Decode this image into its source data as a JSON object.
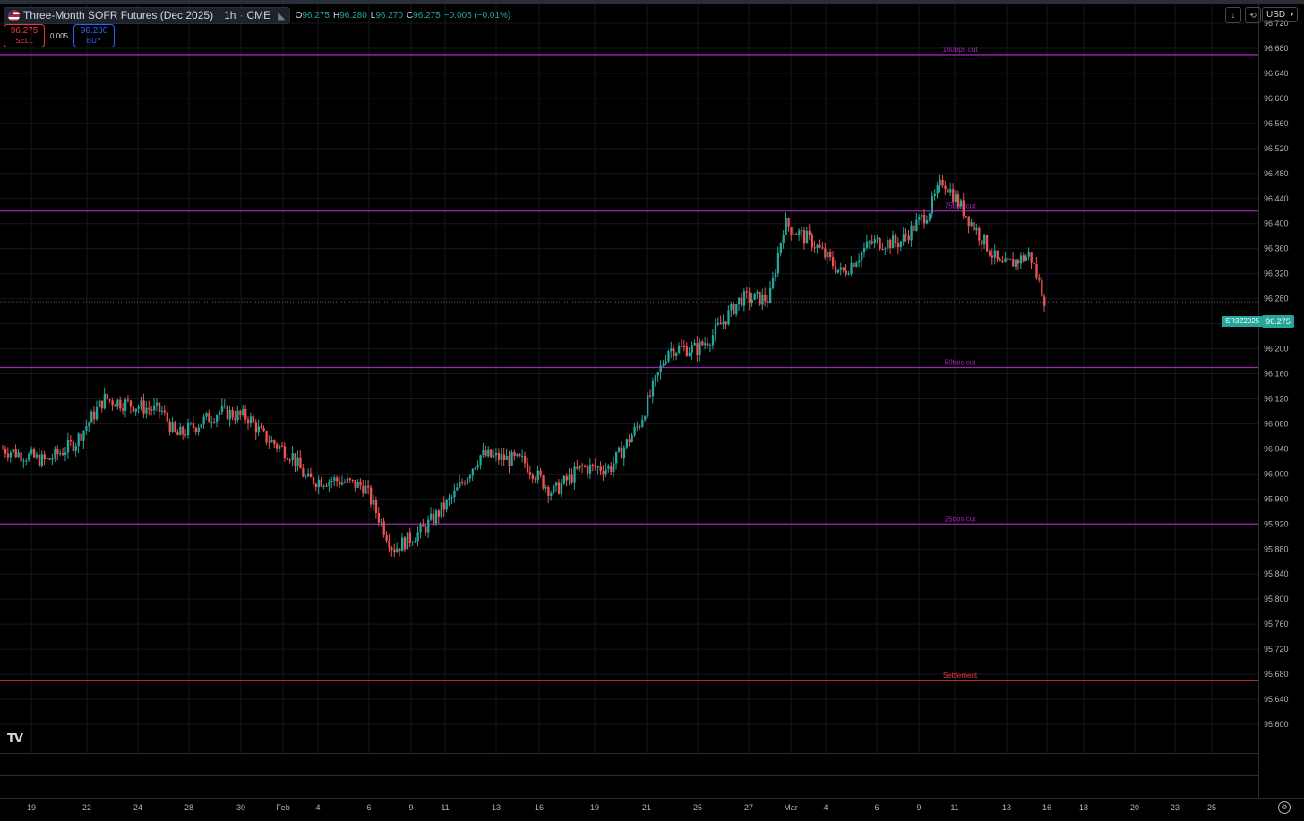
{
  "header": {
    "symbol_title": "Three-Month SOFR Futures (Dec 2025)",
    "interval": "1h",
    "exchange": "CME",
    "ohlc": {
      "o_label": "O",
      "o": "96.275",
      "h_label": "H",
      "h": "96.280",
      "l_label": "L",
      "l": "96.270",
      "c_label": "C",
      "c": "96.275",
      "change": "−0.005 (−0.01%)"
    }
  },
  "trade": {
    "sell_price": "96.275",
    "sell_label": "SELL",
    "spread": "0.005",
    "buy_price": "96.280",
    "buy_label": "BUY"
  },
  "toolbar": {
    "currency": "USD"
  },
  "last_price": {
    "ticker": "SR3Z2025",
    "value": "96.275"
  },
  "colors": {
    "up": "#26a69a",
    "down": "#ef5350",
    "level": "#9c27b0",
    "settlement": "#f23645"
  },
  "price_axis": [
    "96.720",
    "96.680",
    "96.640",
    "96.600",
    "96.560",
    "96.520",
    "96.480",
    "96.440",
    "96.400",
    "96.360",
    "96.320",
    "96.280",
    "96.240",
    "96.200",
    "96.160",
    "96.120",
    "96.080",
    "96.040",
    "96.000",
    "95.960",
    "95.920",
    "95.880",
    "95.840",
    "95.800",
    "95.760",
    "95.720",
    "95.680",
    "95.640",
    "95.600"
  ],
  "time_axis": [
    "19",
    "22",
    "24",
    "28",
    "30",
    "Feb",
    "4",
    "6",
    "9",
    "11",
    "13",
    "16",
    "19",
    "21",
    "25",
    "27",
    "Mar",
    "4",
    "6",
    "9",
    "11",
    "13",
    "16",
    "18",
    "20",
    "23",
    "25"
  ],
  "chart_data": {
    "type": "candlestick",
    "title": "Three-Month SOFR Futures (Dec 2025)",
    "interval": "1h",
    "x_range": [
      "Jan 19",
      "Mar 25"
    ],
    "ylim": [
      95.58,
      96.74
    ],
    "grid": true,
    "last_price": 96.275,
    "horizontal_levels": [
      {
        "label": "100bps cut",
        "value": 96.67,
        "color": "#9c27b0"
      },
      {
        "label": "75bps cut",
        "value": 96.42,
        "color": "#9c27b0"
      },
      {
        "label": "50bps cut",
        "value": 96.17,
        "color": "#9c27b0"
      },
      {
        "label": "25bps cut",
        "value": 95.92,
        "color": "#9c27b0"
      },
      {
        "label": "Settlement",
        "value": 95.67,
        "color": "#f23645"
      }
    ],
    "series": [
      {
        "close": [
          [
            19,
            96.04
          ],
          [
            22,
            96.02
          ],
          [
            24,
            96.05
          ],
          [
            26,
            96.12
          ],
          [
            28,
            96.11
          ],
          [
            30,
            96.1
          ],
          [
            31,
            96.06
          ],
          [
            34,
            96.1
          ],
          [
            36,
            96.09
          ],
          [
            37,
            96.06
          ],
          [
            39,
            96.03
          ],
          [
            40,
            95.99
          ],
          [
            42,
            95.99
          ],
          [
            44,
            95.98
          ],
          [
            46,
            95.88
          ],
          [
            48,
            95.91
          ],
          [
            50,
            95.96
          ],
          [
            52,
            96.03
          ],
          [
            55,
            96.02
          ],
          [
            57,
            95.97
          ],
          [
            59,
            96.01
          ],
          [
            61,
            96.01
          ],
          [
            63,
            96.08
          ],
          [
            65,
            96.2
          ],
          [
            67,
            96.2
          ],
          [
            68,
            96.22
          ],
          [
            70,
            96.28
          ],
          [
            72,
            96.28
          ],
          [
            73,
            96.4
          ],
          [
            75,
            96.37
          ],
          [
            77,
            96.32
          ],
          [
            79,
            96.37
          ],
          [
            81,
            96.37
          ],
          [
            83,
            96.42
          ],
          [
            84,
            96.47
          ],
          [
            86,
            96.4
          ],
          [
            88,
            96.33
          ],
          [
            90,
            96.35
          ],
          [
            91,
            96.28
          ]
        ]
      }
    ]
  }
}
